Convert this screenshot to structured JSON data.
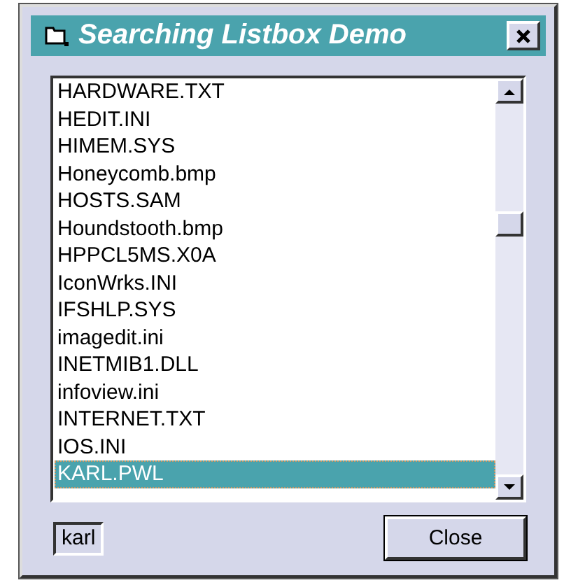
{
  "window": {
    "title": "Searching Listbox Demo"
  },
  "list": {
    "items": [
      {
        "label": "HARDWARE.TXT",
        "selected": false
      },
      {
        "label": "HEDIT.INI",
        "selected": false
      },
      {
        "label": "HIMEM.SYS",
        "selected": false
      },
      {
        "label": "Honeycomb.bmp",
        "selected": false
      },
      {
        "label": "HOSTS.SAM",
        "selected": false
      },
      {
        "label": "Houndstooth.bmp",
        "selected": false
      },
      {
        "label": "HPPCL5MS.X0A",
        "selected": false
      },
      {
        "label": "IconWrks.INI",
        "selected": false
      },
      {
        "label": "IFSHLP.SYS",
        "selected": false
      },
      {
        "label": "imagedit.ini",
        "selected": false
      },
      {
        "label": "INETMIB1.DLL",
        "selected": false
      },
      {
        "label": "infoview.ini",
        "selected": false
      },
      {
        "label": "INTERNET.TXT",
        "selected": false
      },
      {
        "label": "IOS.INI",
        "selected": false
      },
      {
        "label": "KARL.PWL",
        "selected": true
      }
    ]
  },
  "search": {
    "value": "karl"
  },
  "buttons": [
    {
      "label": "Close"
    }
  ]
}
